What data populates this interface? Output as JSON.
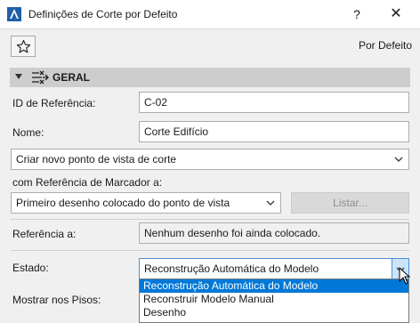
{
  "window": {
    "title": "Definições de Corte por Defeito",
    "help_label": "?",
    "close_label": "✕"
  },
  "toolbar": {
    "favorites_icon": "star-icon",
    "defaults_label": "Por Defeito"
  },
  "panel": {
    "title": "GERAL",
    "icon": "section-settings-icon"
  },
  "form": {
    "reference_id_label": "ID de Referência:",
    "reference_id_value": "C-02",
    "name_label": "Nome:",
    "name_value": "Corte Edifício",
    "viewpoint_select_value": "Criar novo ponto de vista de corte",
    "marker_ref_label": "com Referência de Marcador a:",
    "marker_ref_select_value": "Primeiro desenho colocado do ponto de vista",
    "list_button_label": "Listar...",
    "reference_to_label": "Referência a:",
    "reference_to_value": "Nenhum desenho foi ainda colocado.",
    "status_label": "Estado:",
    "status_value": "Reconstrução Automática do Modelo",
    "show_on_floors_label": "Mostrar nos Pisos:"
  },
  "status_dropdown": {
    "options": [
      "Reconstrução Automática do Modelo",
      "Reconstruir Modelo Manual",
      "Desenho"
    ],
    "selected_index": 0
  },
  "colors": {
    "selection": "#0078d7",
    "header_bg": "#cdcdcd",
    "focus_border": "#4a90d9"
  }
}
